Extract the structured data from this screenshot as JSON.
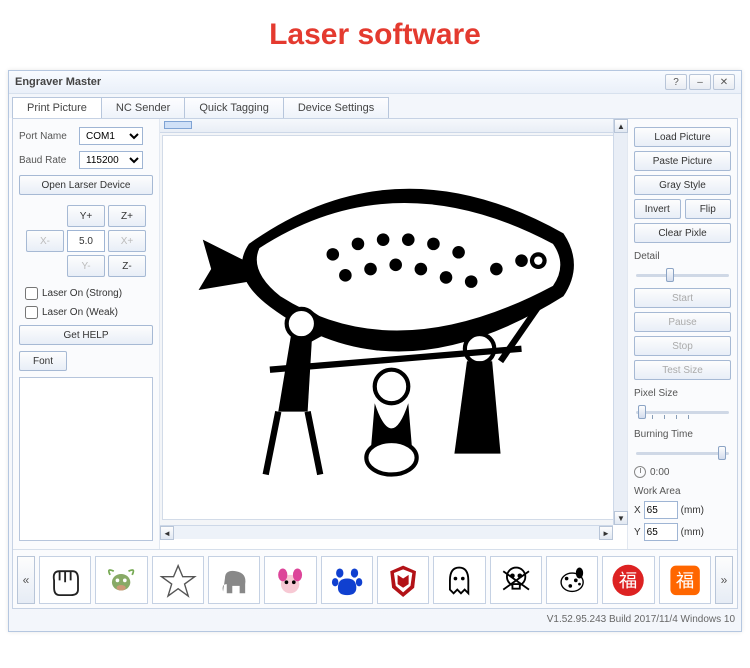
{
  "page_title": "Laser software",
  "window": {
    "title": "Engraver Master",
    "tabs": [
      "Print Picture",
      "NC Sender",
      "Quick Tagging",
      "Device Settings"
    ],
    "active_tab": 0
  },
  "left": {
    "port_name_label": "Port Name",
    "port_name_value": "COM1",
    "baud_rate_label": "Baud Rate",
    "baud_rate_value": "115200",
    "open_device": "Open Larser Device",
    "jog": {
      "yplus": "Y+",
      "zplus": "Z+",
      "xminus": "X-",
      "step": "5.0",
      "xplus": "X+",
      "yminus": "Y-",
      "zminus": "Z-"
    },
    "laser_strong": "Laser On (Strong)",
    "laser_weak": "Laser On (Weak)",
    "get_help": "Get HELP",
    "font_btn": "Font"
  },
  "right": {
    "load_picture": "Load Picture",
    "paste_picture": "Paste Picture",
    "gray_style": "Gray Style",
    "invert": "Invert",
    "flip": "Flip",
    "clear_pixle": "Clear Pixle",
    "detail_label": "Detail",
    "start": "Start",
    "pause": "Pause",
    "stop": "Stop",
    "test_size": "Test Size",
    "pixel_size_label": "Pixel Size",
    "burning_time_label": "Burning Time",
    "timer_value": "0:00",
    "work_area_label": "Work Area",
    "x_label": "X",
    "y_label": "Y",
    "x_value": "65",
    "y_value": "65",
    "mm": "(mm)"
  },
  "gallery": {
    "items": [
      "fist",
      "bull",
      "star",
      "elephant",
      "puppy",
      "paw",
      "autobot",
      "ghost",
      "skull",
      "dalmatian",
      "fu-red",
      "fu-orange"
    ]
  },
  "status": "V1.52.95.243 Build 2017/11/4 Windows 10"
}
